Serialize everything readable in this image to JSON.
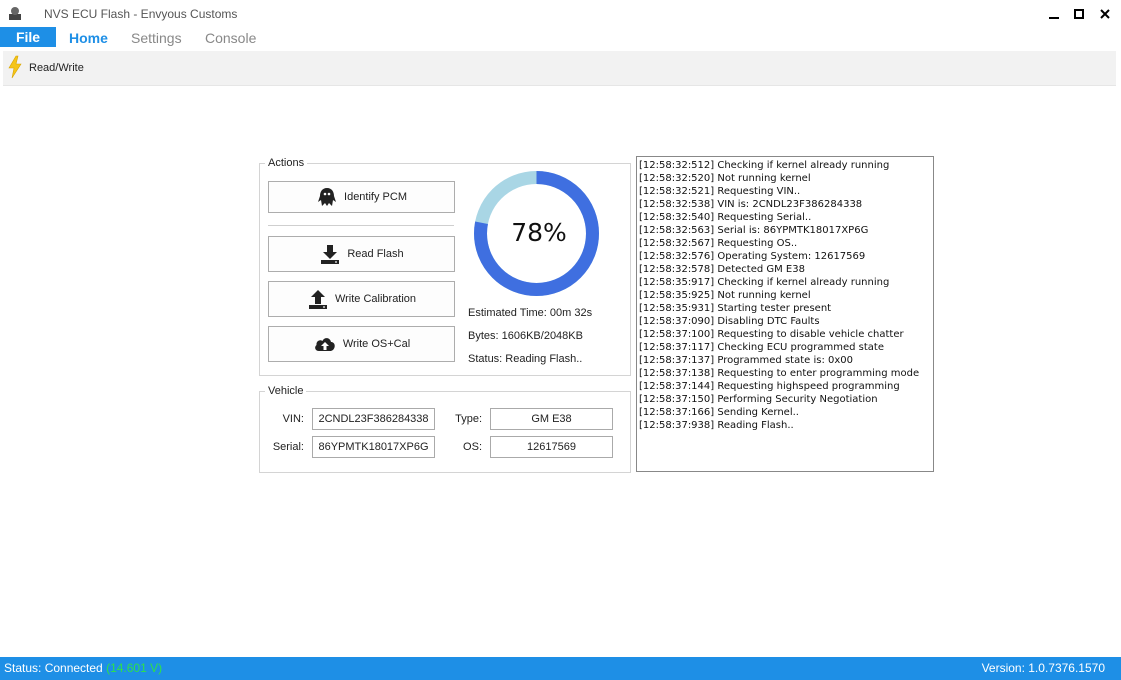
{
  "window": {
    "title": "NVS ECU Flash - Envyous Customs"
  },
  "ribbon": {
    "file_label": "File",
    "tabs": [
      {
        "label": "Home",
        "active": true
      },
      {
        "label": "Settings",
        "active": false
      },
      {
        "label": "Console",
        "active": false
      }
    ],
    "read_write_label": "Read/Write"
  },
  "actions": {
    "title": "Actions",
    "identify_label": "Identify PCM",
    "read_flash_label": "Read Flash",
    "write_cal_label": "Write Calibration",
    "write_os_label": "Write OS+Cal"
  },
  "progress": {
    "percent": 78,
    "percent_label": "78%",
    "estimated_time": "Estimated Time: 00m 32s",
    "bytes": "Bytes: 1606KB/2048KB",
    "status": "Status: Reading Flash.."
  },
  "vehicle": {
    "title": "Vehicle",
    "vin_label": "VIN:",
    "vin": "2CNDL23F386284338",
    "type_label": "Type:",
    "type": "GM E38",
    "serial_label": "Serial:",
    "serial": "86YPMTK18017XP6G",
    "os_label": "OS:",
    "os": "12617569"
  },
  "log": [
    "[12:58:32:512]  Checking if kernel already running",
    "[12:58:32:520]  Not running kernel",
    "[12:58:32:521]  Requesting VIN..",
    "[12:58:32:538]  VIN is: 2CNDL23F386284338",
    "[12:58:32:540]  Requesting Serial..",
    "[12:58:32:563]  Serial is: 86YPMTK18017XP6G",
    "[12:58:32:567]  Requesting OS..",
    "[12:58:32:576]  Operating System: 12617569",
    "[12:58:32:578]  Detected GM E38",
    "[12:58:35:917]  Checking if kernel already running",
    "[12:58:35:925]  Not running kernel",
    "[12:58:35:931]  Starting tester present",
    "[12:58:37:090]  Disabling DTC Faults",
    "[12:58:37:100]  Requesting to disable vehicle chatter",
    "[12:58:37:117]  Checking ECU programmed state",
    "[12:58:37:137]  Programmed state is: 0x00",
    "[12:58:37:138]  Requesting to enter programming mode",
    "[12:58:37:144]  Requesting highspeed programming",
    "[12:58:37:150]  Performing Security Negotiation",
    "[12:58:37:166]  Sending Kernel..",
    "[12:58:37:938]  Reading Flash.."
  ],
  "status_bar": {
    "status": "Status: Connected",
    "voltage": "(14.601 V)",
    "version": "Version: 1.0.7376.1570"
  },
  "colors": {
    "accent": "#1e8fe6",
    "progress_fill": "#3f6fe0",
    "progress_track": "#a9d6e5",
    "voltage": "#2ee04a"
  },
  "icons": {
    "app": "app-icon",
    "read_write": "lightning-icon",
    "identify": "ghost-icon",
    "read_flash": "download-icon",
    "write_cal": "upload-icon",
    "write_os": "cloud-upload-icon"
  }
}
